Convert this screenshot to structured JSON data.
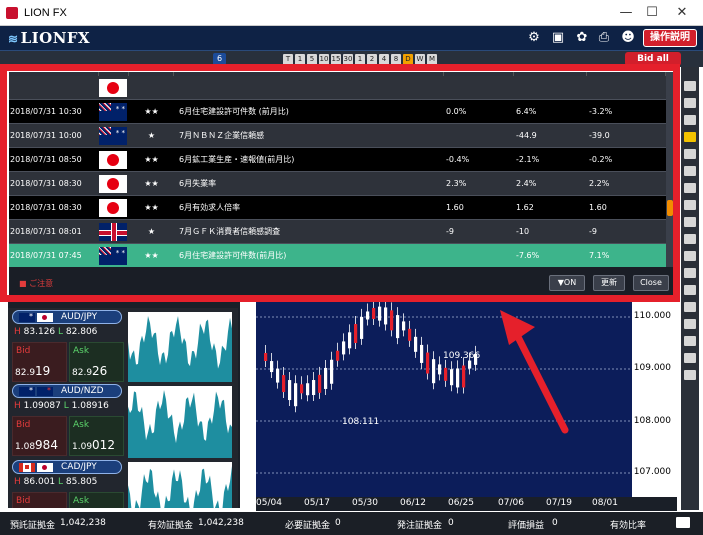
{
  "window": {
    "title": "LION FX",
    "minimize": "—",
    "maximize": "☐",
    "close": "✕"
  },
  "header": {
    "logo": "LIONFX",
    "help_button": "操作説明",
    "bid_all": "Bid all",
    "badge_count": "6"
  },
  "timeframes": [
    "T",
    "1",
    "5",
    "10",
    "15",
    "30",
    "1",
    "2",
    "4",
    "8",
    "D",
    "W",
    "M"
  ],
  "calendar": {
    "columns": [
      "日付",
      "国",
      "重要度",
      "タイトル",
      "予想",
      "結果",
      "前回"
    ],
    "rows": [
      {
        "date": "2018/07/31 10:30",
        "country": "au",
        "importance": "★★",
        "title": "6月住宅建設許可件数 (前月比)",
        "forecast": "0.0%",
        "result": "6.4%",
        "previous": "-3.2%",
        "style": "dark"
      },
      {
        "date": "2018/07/31 10:00",
        "country": "nz",
        "importance": "★",
        "title": "7月ＮＢＮＺ企業信頼感",
        "forecast": "",
        "result": "-44.9",
        "previous": "-39.0",
        "style": "gray"
      },
      {
        "date": "2018/07/31 08:50",
        "country": "jp",
        "importance": "★★",
        "title": "6月鉱工業生産・速報値(前月比)",
        "forecast": "-0.4%",
        "result": "-2.1%",
        "previous": "-0.2%",
        "style": "dark"
      },
      {
        "date": "2018/07/31 08:30",
        "country": "jp",
        "importance": "★★",
        "title": "6月失業率",
        "forecast": "2.3%",
        "result": "2.4%",
        "previous": "2.2%",
        "style": "gray"
      },
      {
        "date": "2018/07/31 08:30",
        "country": "jp",
        "importance": "★★",
        "title": "6月有効求人倍率",
        "forecast": "1.60",
        "result": "1.62",
        "previous": "1.60",
        "style": "dark"
      },
      {
        "date": "2018/07/31 08:01",
        "country": "uk",
        "importance": "★",
        "title": "7月ＧＦＫ消費者信頼感調査",
        "forecast": "-9",
        "result": "-10",
        "previous": "-9",
        "style": "gray"
      },
      {
        "date": "2018/07/31 07:45",
        "country": "nz",
        "importance": "★★",
        "title": "6月住宅建設許可件数(前月比)",
        "forecast": "",
        "result": "-7.6%",
        "previous": "7.1%",
        "style": "green"
      }
    ],
    "legend": "■ ご注意",
    "buttons": {
      "toggle": "▼ON",
      "refresh": "更新",
      "close": "Close"
    }
  },
  "rates": [
    {
      "pair": "AUD/JPY",
      "high": "83.126",
      "low": "82.806",
      "bid_small": "82.9",
      "bid_big": "19",
      "ask_small": "82.9",
      "ask_big": "26",
      "flags": [
        "au",
        "jp"
      ]
    },
    {
      "pair": "AUD/NZD",
      "high": "1.09087",
      "low": "1.08916",
      "bid_small": "1.08",
      "bid_big": "984",
      "ask_small": "1.09",
      "ask_big": "012",
      "flags": [
        "au",
        "nz"
      ]
    },
    {
      "pair": "CAD/JPY",
      "high": "86.001",
      "low": "85.805",
      "bid_small": "",
      "bid_big": "",
      "ask_small": "",
      "ask_big": "",
      "flags": [
        "ca",
        "jp"
      ]
    }
  ],
  "labels": {
    "high": "H",
    "low": "L",
    "bid": "Bid",
    "ask": "Ask"
  },
  "chart": {
    "y_ticks": [
      "110.000",
      "109.000",
      "108.000",
      "107.000"
    ],
    "x_ticks": [
      "05/04",
      "05/17",
      "05/30",
      "06/12",
      "06/25",
      "07/06",
      "07/19",
      "08/01"
    ],
    "annotations": [
      "109.366",
      "108.111"
    ]
  },
  "status": {
    "deposit_label": "預託証拠金",
    "deposit_value": "1,042,238",
    "valid_label": "有効証拠金",
    "valid_value": "1,042,238",
    "required_label": "必要証拠金",
    "required_value": "0",
    "order_label": "発注証拠金",
    "order_value": "0",
    "pnl_label": "評価損益",
    "pnl_value": "0",
    "ratio_label": "有効比率"
  }
}
